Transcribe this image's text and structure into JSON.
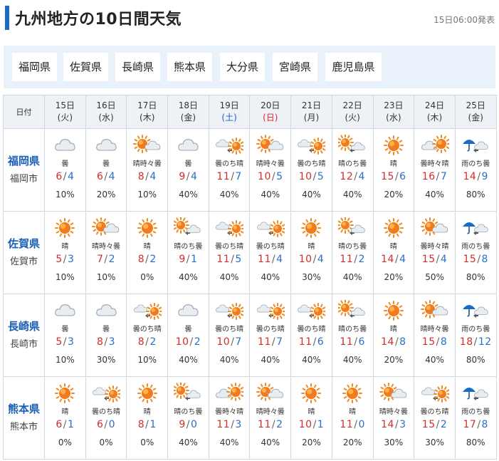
{
  "page": {
    "title": "九州地方の10日間天気",
    "issued": "15日06:00発表"
  },
  "prefectures": [
    "福岡県",
    "佐賀県",
    "長崎県",
    "熊本県",
    "大分県",
    "宮崎県",
    "鹿児島県"
  ],
  "table": {
    "header_label": "日付",
    "days": [
      {
        "date": "15日",
        "dow": "(火)",
        "dow_type": "weekday"
      },
      {
        "date": "16日",
        "dow": "(水)",
        "dow_type": "weekday"
      },
      {
        "date": "17日",
        "dow": "(木)",
        "dow_type": "weekday"
      },
      {
        "date": "18日",
        "dow": "(金)",
        "dow_type": "weekday"
      },
      {
        "date": "19日",
        "dow": "(土)",
        "dow_type": "saturday"
      },
      {
        "date": "20日",
        "dow": "(日)",
        "dow_type": "sunday"
      },
      {
        "date": "21日",
        "dow": "(月)",
        "dow_type": "weekday"
      },
      {
        "date": "22日",
        "dow": "(火)",
        "dow_type": "weekday"
      },
      {
        "date": "23日",
        "dow": "(水)",
        "dow_type": "weekday"
      },
      {
        "date": "24日",
        "dow": "(木)",
        "dow_type": "weekday"
      },
      {
        "date": "25日",
        "dow": "(金)",
        "dow_type": "weekday"
      }
    ],
    "rows": [
      {
        "pref": "福岡県",
        "city": "福岡市",
        "cells": [
          {
            "icon": "cloudy-icon",
            "weather": "曇",
            "hi": "6",
            "lo": "4",
            "pop": "10%"
          },
          {
            "icon": "cloudy-icon",
            "weather": "曇",
            "hi": "6",
            "lo": "4",
            "pop": "20%"
          },
          {
            "icon": "sun-cloud-icon",
            "weather": "晴時々曇",
            "hi": "8",
            "lo": "4",
            "pop": "10%"
          },
          {
            "icon": "cloudy-icon",
            "weather": "曇",
            "hi": "9",
            "lo": "4",
            "pop": "40%"
          },
          {
            "icon": "cloud-then-sun-icon",
            "weather": "曇のち晴",
            "hi": "11",
            "lo": "7",
            "pop": "40%"
          },
          {
            "icon": "sun-cloud-icon",
            "weather": "晴時々曇",
            "hi": "10",
            "lo": "5",
            "pop": "40%"
          },
          {
            "icon": "cloud-then-sun-icon",
            "weather": "曇のち晴",
            "hi": "10",
            "lo": "5",
            "pop": "40%"
          },
          {
            "icon": "sun-then-cloud-icon",
            "weather": "晴のち曇",
            "hi": "12",
            "lo": "4",
            "pop": "40%"
          },
          {
            "icon": "sunny-icon",
            "weather": "晴",
            "hi": "15",
            "lo": "6",
            "pop": "20%"
          },
          {
            "icon": "cloud-sun-icon",
            "weather": "曇時々晴",
            "hi": "16",
            "lo": "7",
            "pop": "40%"
          },
          {
            "icon": "rain-then-cloud-icon",
            "weather": "雨のち曇",
            "hi": "14",
            "lo": "9",
            "pop": "80%"
          }
        ]
      },
      {
        "pref": "佐賀県",
        "city": "佐賀市",
        "cells": [
          {
            "icon": "sunny-icon",
            "weather": "晴",
            "hi": "5",
            "lo": "3",
            "pop": "10%"
          },
          {
            "icon": "sun-cloud-icon",
            "weather": "晴時々曇",
            "hi": "7",
            "lo": "2",
            "pop": "10%"
          },
          {
            "icon": "sunny-icon",
            "weather": "晴",
            "hi": "8",
            "lo": "2",
            "pop": "0%"
          },
          {
            "icon": "sun-then-cloud-icon",
            "weather": "晴のち曇",
            "hi": "9",
            "lo": "1",
            "pop": "40%"
          },
          {
            "icon": "cloud-then-sun-icon",
            "weather": "曇のち晴",
            "hi": "11",
            "lo": "5",
            "pop": "40%"
          },
          {
            "icon": "cloud-then-sun-icon",
            "weather": "曇のち晴",
            "hi": "11",
            "lo": "4",
            "pop": "40%"
          },
          {
            "icon": "sunny-icon",
            "weather": "晴",
            "hi": "10",
            "lo": "4",
            "pop": "30%"
          },
          {
            "icon": "sun-then-cloud-icon",
            "weather": "晴のち曇",
            "hi": "11",
            "lo": "2",
            "pop": "40%"
          },
          {
            "icon": "sunny-icon",
            "weather": "晴",
            "hi": "14",
            "lo": "4",
            "pop": "20%"
          },
          {
            "icon": "sun-cloud-icon",
            "weather": "曇時々晴",
            "hi": "15",
            "lo": "4",
            "pop": "50%"
          },
          {
            "icon": "rain-then-cloud-icon",
            "weather": "雨のち曇",
            "hi": "15",
            "lo": "8",
            "pop": "80%"
          }
        ]
      },
      {
        "pref": "長崎県",
        "city": "長崎市",
        "cells": [
          {
            "icon": "cloudy-icon",
            "weather": "曇",
            "hi": "5",
            "lo": "3",
            "pop": "10%"
          },
          {
            "icon": "cloudy-icon",
            "weather": "曇",
            "hi": "8",
            "lo": "3",
            "pop": "30%"
          },
          {
            "icon": "cloud-then-sun-icon",
            "weather": "曇のち晴",
            "hi": "8",
            "lo": "2",
            "pop": "10%"
          },
          {
            "icon": "cloudy-icon",
            "weather": "曇",
            "hi": "10",
            "lo": "2",
            "pop": "40%"
          },
          {
            "icon": "cloud-then-sun-icon",
            "weather": "曇のち晴",
            "hi": "10",
            "lo": "7",
            "pop": "40%"
          },
          {
            "icon": "cloud-then-sun-icon",
            "weather": "曇のち晴",
            "hi": "11",
            "lo": "7",
            "pop": "40%"
          },
          {
            "icon": "cloud-then-sun-icon",
            "weather": "曇のち晴",
            "hi": "11",
            "lo": "6",
            "pop": "40%"
          },
          {
            "icon": "sun-then-cloud-icon",
            "weather": "晴のち曇",
            "hi": "11",
            "lo": "6",
            "pop": "40%"
          },
          {
            "icon": "sunny-icon",
            "weather": "晴",
            "hi": "14",
            "lo": "8",
            "pop": "20%"
          },
          {
            "icon": "sun-cloud-icon",
            "weather": "晴時々曇",
            "hi": "15",
            "lo": "8",
            "pop": "40%"
          },
          {
            "icon": "rain-then-cloud-icon",
            "weather": "雨のち曇",
            "hi": "18",
            "lo": "12",
            "pop": "80%"
          }
        ]
      },
      {
        "pref": "熊本県",
        "city": "熊本市",
        "cells": [
          {
            "icon": "sunny-icon",
            "weather": "晴",
            "hi": "6",
            "lo": "1",
            "pop": "0%"
          },
          {
            "icon": "cloud-then-sun-icon",
            "weather": "曇のち晴",
            "hi": "6",
            "lo": "0",
            "pop": "0%"
          },
          {
            "icon": "sunny-icon",
            "weather": "晴",
            "hi": "8",
            "lo": "1",
            "pop": "0%"
          },
          {
            "icon": "sun-then-cloud-icon",
            "weather": "晴のち曇",
            "hi": "9",
            "lo": "0",
            "pop": "40%"
          },
          {
            "icon": "cloud-sun-icon",
            "weather": "曇時々晴",
            "hi": "11",
            "lo": "3",
            "pop": "40%"
          },
          {
            "icon": "sun-cloud-icon",
            "weather": "晴時々曇",
            "hi": "11",
            "lo": "2",
            "pop": "40%"
          },
          {
            "icon": "sunny-icon",
            "weather": "晴",
            "hi": "10",
            "lo": "1",
            "pop": "20%"
          },
          {
            "icon": "sunny-icon",
            "weather": "晴",
            "hi": "11",
            "lo": "0",
            "pop": "20%"
          },
          {
            "icon": "sun-cloud-icon",
            "weather": "晴時々曇",
            "hi": "14",
            "lo": "3",
            "pop": "30%"
          },
          {
            "icon": "cloud-then-sun-icon",
            "weather": "曇のち晴",
            "hi": "15",
            "lo": "2",
            "pop": "30%"
          },
          {
            "icon": "rain-then-cloud-icon",
            "weather": "雨のち曇",
            "hi": "17",
            "lo": "8",
            "pop": "80%"
          }
        ]
      }
    ]
  },
  "colors": {
    "accent": "#1a6bc8",
    "high_temp": "#d42c2c",
    "low_temp": "#2a6fc7",
    "saturday": "#1560c9",
    "sunday": "#d6262b",
    "pref_link": "#1a5fb8",
    "pref_box_bg": "#e9f1fb"
  }
}
